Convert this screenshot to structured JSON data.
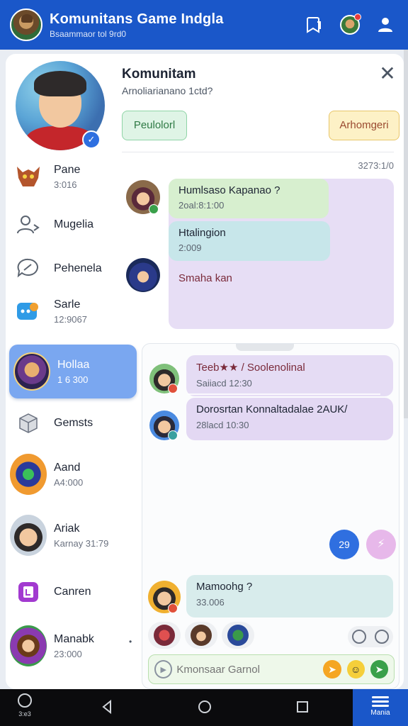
{
  "header": {
    "title": "Komunitans Game Indgla",
    "subtitle": "Bsaammaor tol 9rd0"
  },
  "panel": {
    "title": "Komunitam",
    "subtitle": "Arnoliarianano 1ctd?",
    "button_left": "Peulolorl",
    "button_right": "Arhomgeri",
    "timestamp": "3273:1/0"
  },
  "sidebar": {
    "items": [
      {
        "name": "Pane",
        "sub": "3:016"
      },
      {
        "name": "Mugelia",
        "sub": ""
      },
      {
        "name": "Pehenela",
        "sub": ""
      },
      {
        "name": "Sarle",
        "sub": "12:9067"
      },
      {
        "name": "Hollaa",
        "sub": "1 6 300"
      },
      {
        "name": "Gemsts",
        "sub": ""
      },
      {
        "name": "Aand",
        "sub": "A4:000"
      },
      {
        "name": "Ariak",
        "sub": "Karnay 31:79"
      },
      {
        "name": "Canren",
        "sub": ""
      },
      {
        "name": "Manabk",
        "sub": "23:000"
      }
    ]
  },
  "upper_chat": [
    {
      "text": "Humlsaso Kapanao ?",
      "sub": "2oal:8:1:00"
    },
    {
      "text": "Htalingion",
      "sub": "2:009"
    },
    {
      "text": "Smaha kan",
      "sub": ""
    }
  ],
  "lower_chat": [
    {
      "text": "Teeb★★ / Soolenolinal",
      "sub": "Saiiacd 12:30"
    },
    {
      "text": "Dorosrtan Konnaltadalae 2AUK/",
      "sub": "28lacd 10:30"
    },
    {
      "text": "Mamoohg ?",
      "sub": "33.006"
    }
  ],
  "controls": {
    "blue_button": "29",
    "purple_button": "⚡"
  },
  "input": {
    "placeholder": "Kmonsaar Garnol"
  },
  "navbar": {
    "left_label": "3:e3",
    "right_label": "Mania"
  },
  "colors": {
    "brand": "#1a57c9",
    "active_item": "#7aa7f0"
  }
}
